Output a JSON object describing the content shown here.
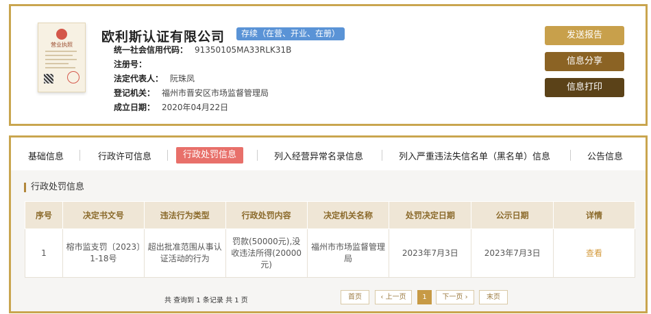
{
  "company": {
    "name": "欧利斯认证有限公司",
    "status": "存续（在营、开业、在册）",
    "license_lettering": "营业执照"
  },
  "info": [
    {
      "key": "统一社会信用代码：",
      "value": "91350105MA33RLK31B"
    },
    {
      "key": "注册号：",
      "value": ""
    },
    {
      "key": "法定代表人：",
      "value": "阮珠凤"
    },
    {
      "key": "登记机关：",
      "value": "福州市晋安区市场监督管理局"
    },
    {
      "key": "成立日期：",
      "value": "2020年04月22日"
    }
  ],
  "actions": {
    "send_report": "发送报告",
    "share": "信息分享",
    "print": "信息打印"
  },
  "colors": {
    "gold_border": "#c9a54e",
    "btn_send": "#c8a04b",
    "btn_share": "#8b6324",
    "btn_print": "#5b4218",
    "active_tab": "#e8706a",
    "status_badge": "#5a93d6"
  },
  "tabs": [
    "基础信息",
    "行政许可信息",
    "行政处罚信息",
    "列入经营异常名录信息",
    "列入严重违法失信名单（黑名单）信息",
    "公告信息"
  ],
  "active_tab": "行政处罚信息",
  "section_title": "行政处罚信息",
  "table": {
    "headers": [
      "序号",
      "决定书文号",
      "违法行为类型",
      "行政处罚内容",
      "决定机关名称",
      "处罚决定日期",
      "公示日期",
      "详情"
    ],
    "rows": [
      [
        "1",
        "榕市监支罚〔2023〕1-18号",
        "超出批准范围从事认证活动的行为",
        "罚款(50000元),没收违法所得(20000元)",
        "福州市市场监督管理局",
        "2023年7月3日",
        "2023年7月3日",
        "查看"
      ]
    ]
  },
  "pagination": {
    "total_text": "共 查询到 1 条记录 共 1 页",
    "first": "首页",
    "prev": "‹ 上一页",
    "current": "1",
    "next": "下一页 ›",
    "last": "末页"
  }
}
